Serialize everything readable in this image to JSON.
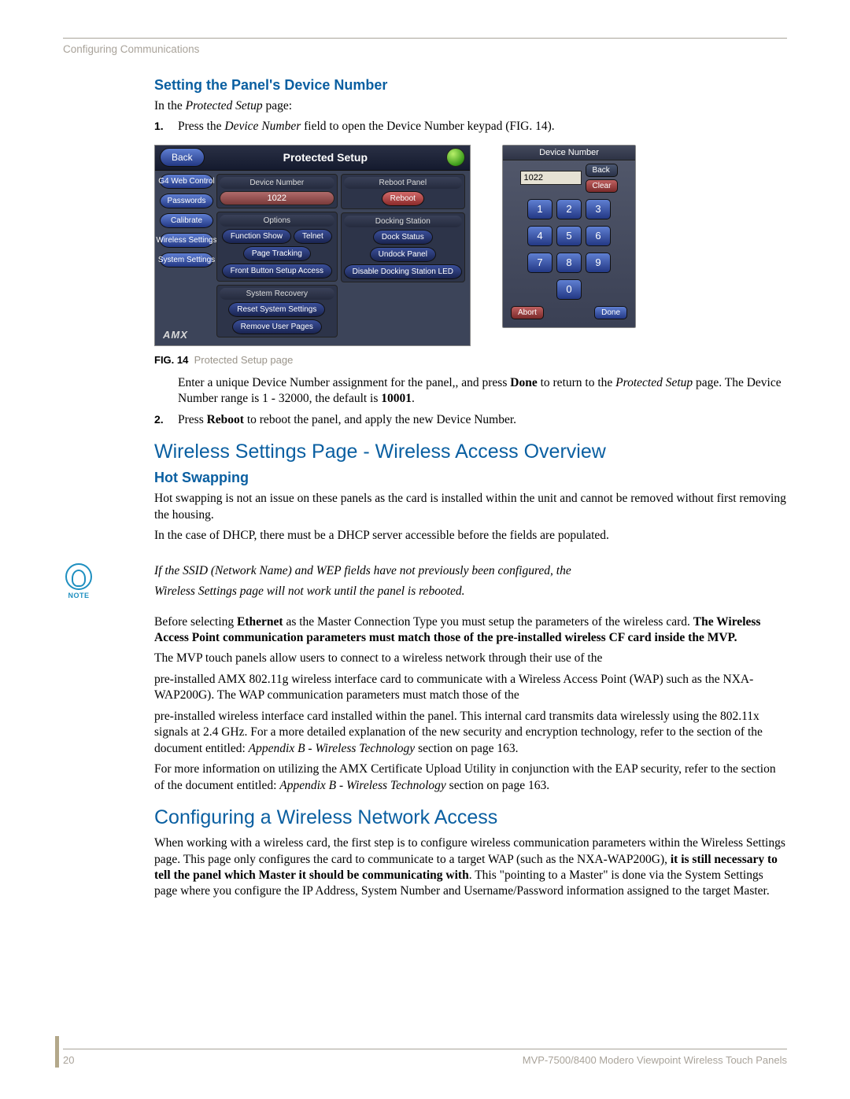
{
  "header": "Configuring Communications",
  "s1": {
    "title": "Setting the Panel's Device Number",
    "intro_pre": "In the ",
    "intro_it": "Protected Setup",
    "intro_post": " page:",
    "li1_pre": "Press the ",
    "li1_it": "Device Number",
    "li1_post": " field to open the Device Number keypad (FIG. 14).",
    "after_fig_1a": "Enter a unique Device Number assignment for the panel",
    "after_fig_1b": ", and press ",
    "after_fig_done": "Done",
    "after_fig_1c": " to return to the ",
    "after_fig_it": "Protected Setup",
    "after_fig_1d": " page. The Device Number range is 1 - 32000, the default is ",
    "after_fig_default": "10001",
    "after_fig_1e": ".",
    "li2_pre": "Press ",
    "li2_b": "Reboot",
    "li2_post": " to reboot the panel, and apply the new Device Number."
  },
  "fig": {
    "num": "FIG. 14",
    "caption": "Protected Setup page"
  },
  "panel": {
    "back": "Back",
    "title": "Protected Setup",
    "sidebar": [
      "G4 Web Control",
      "Passwords",
      "Calibrate",
      "Wireless Settings",
      "System Settings"
    ],
    "devnum_label": "Device Number",
    "devnum_value": "1022",
    "options_label": "Options",
    "opt_fs": "Function Show",
    "opt_telnet": "Telnet",
    "opt_pt": "Page Tracking",
    "opt_fba": "Front Button Setup Access",
    "sysrec_label": "System Recovery",
    "sr1": "Reset System Settings",
    "sr2": "Remove User Pages",
    "reboot_label": "Reboot Panel",
    "reboot_btn": "Reboot",
    "dock_label": "Docking Station",
    "ds1": "Dock Status",
    "ds2": "Undock Panel",
    "ds3": "Disable Docking Station LED",
    "brand": "AMX"
  },
  "keypad": {
    "title": "Device Number",
    "value": "1022",
    "back": "Back",
    "clear": "Clear",
    "abort": "Abort",
    "done": "Done",
    "keys": [
      "1",
      "2",
      "3",
      "4",
      "5",
      "6",
      "7",
      "8",
      "9",
      "0"
    ]
  },
  "s2": {
    "title": "Wireless Settings Page - Wireless Access Overview",
    "sub": "Hot Swapping",
    "p1": "Hot swapping is not an issue on these panels as the card is installed within the unit and cannot be removed without first removing the housing.",
    "p2": "In the case of DHCP, there must be a DHCP server accessible before the fields are populated.",
    "note1": "If the SSID (Network Name) and WEP fields have not previously been configured, the",
    "note2": "Wireless Settings page will not work until the panel is rebooted.",
    "p3a": "Before selecting ",
    "p3b": "Ethernet",
    "p3c": " as the Master Connection Type you must setup the parameters of the wireless card. ",
    "p3d": "The Wireless Access Point communication parameters must match those of the pre-installed wireless CF card inside the MVP.",
    "p4": "The MVP touch panels allow users to connect to a wireless network through their use of the",
    "p5": "pre-installed AMX 802.11g wireless interface card to communicate with a Wireless Access Point (WAP) such as the NXA-WAP200G). The WAP communication parameters must match those of the",
    "p6a": "pre-installed wireless interface card installed within the panel. This internal card transmits data wirelessly using the 802.11x signals at 2.4 GHz. For a more detailed explanation of the new security and encryption technology, refer to the section of the document entitled: ",
    "p6it": "Appendix B - Wireless Technology",
    "p6b": " section on page 163.",
    "p7a": "For more information on utilizing the AMX Certificate Upload Utility in conjunction with the EAP security, refer to the section of the document entitled: ",
    "p7it": "Appendix B - Wireless Technology",
    "p7b": " section on page 163."
  },
  "s3": {
    "title": "Configuring a Wireless Network Access",
    "p1a": "When working with a wireless card, the first step is to configure wireless communication parameters within the Wireless Settings page. This page only configures the card to communicate to a target WAP (such as the NXA-WAP200G), ",
    "p1b": "it is still necessary to tell the panel which Master it should be communicating with",
    "p1c": ". This \"pointing to a Master\" is done via the System Settings page where you configure the IP Address, System Number and Username/Password information assigned to the target Master."
  },
  "footer": {
    "page": "20",
    "doc": "MVP-7500/8400 Modero Viewpoint Wireless Touch Panels"
  }
}
